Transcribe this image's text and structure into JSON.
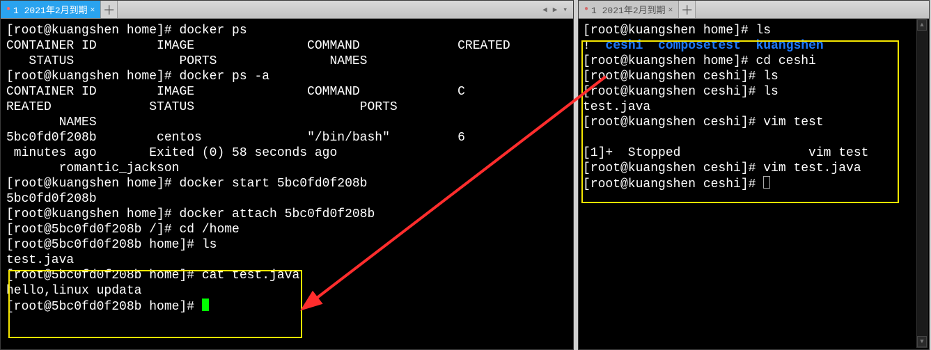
{
  "tabs": {
    "left": {
      "label": "1 2021年2月到期"
    },
    "right": {
      "label": "1 2021年2月到期"
    }
  },
  "left_terminal": {
    "l01": "[root@kuangshen home]# docker ps",
    "l02": "CONTAINER ID        IMAGE               COMMAND             CREATED",
    "l03": "   STATUS              PORTS               NAMES",
    "l04": "[root@kuangshen home]# docker ps -a",
    "l05": "CONTAINER ID        IMAGE               COMMAND             C",
    "l06": "REATED             STATUS                      PORTS",
    "l07": "       NAMES",
    "l08": "5bc0fd0f208b        centos              \"/bin/bash\"         6",
    "l09": " minutes ago       Exited (0) 58 seconds ago",
    "l10": "       romantic_jackson",
    "l11": "[root@kuangshen home]# docker start 5bc0fd0f208b",
    "l12": "5bc0fd0f208b",
    "l13": "[root@kuangshen home]# docker attach 5bc0fd0f208b",
    "l14": "[root@5bc0fd0f208b /]# cd /home",
    "l15": "[root@5bc0fd0f208b home]# ls",
    "l16": "test.java",
    "l17": "[root@5bc0fd0f208b home]# cat test.java",
    "l18": "hello,linux updata",
    "l19": "[root@5bc0fd0f208b home]# "
  },
  "right_terminal": {
    "r01": "[root@kuangshen home]# ls",
    "r02a": "!",
    "r02b": "ceshi",
    "r02c": "composetest",
    "r02d": "kuangshen",
    "r03": "[root@kuangshen home]# cd ceshi",
    "r04": "[root@kuangshen ceshi]# ls",
    "r05": "[root@kuangshen ceshi]# ls",
    "r06": "test.java",
    "r07": "[root@kuangshen ceshi]# vim test",
    "r08": " ",
    "r09": "[1]+  Stopped                 vim test",
    "r10": "[root@kuangshen ceshi]# vim test.java",
    "r11": "[root@kuangshen ceshi]# "
  },
  "colors": {
    "highlight_yellow": "#f5e600",
    "arrow_red": "#ff2d2d",
    "dir_blue": "#1d7aff",
    "tab_active": "#2aa3ef"
  }
}
